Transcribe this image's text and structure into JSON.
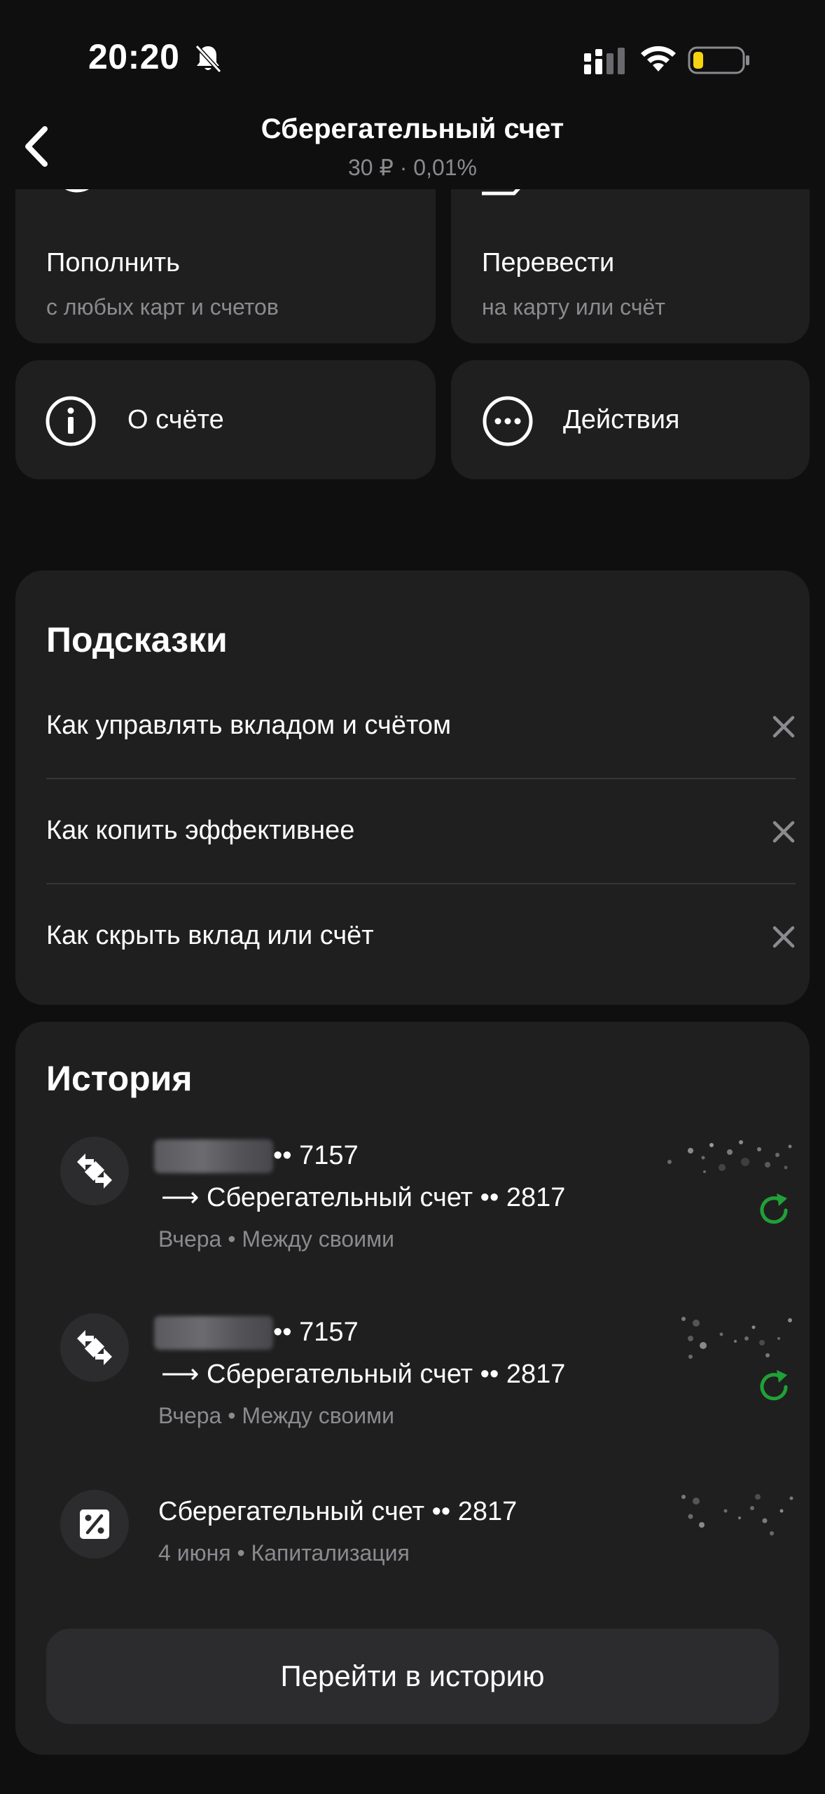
{
  "status_bar": {
    "time": "20:20"
  },
  "header": {
    "title": "Сберегательный счет",
    "subtitle": "30 ₽ · 0,01%"
  },
  "actions": {
    "top_up": {
      "title": "Пополнить",
      "subtitle": "с любых карт и счетов"
    },
    "transfer": {
      "title": "Перевести",
      "subtitle": "на карту или счёт"
    },
    "about": {
      "label": "О счёте"
    },
    "more": {
      "label": "Действия"
    }
  },
  "hints": {
    "title": "Подсказки",
    "items": [
      {
        "label": "Как управлять вкладом и счётом"
      },
      {
        "label": "Как копить эффективнее"
      },
      {
        "label": "Как скрыть вклад или счёт"
      }
    ]
  },
  "history": {
    "title": "История",
    "items": [
      {
        "from_suffix": "•• 7157",
        "to": "⟶ Сберегательный счет •• 2817",
        "meta": "Вчера • Между своими"
      },
      {
        "from_suffix": "•• 7157",
        "to": "⟶ Сберегательный счет •• 2817",
        "meta": "Вчера • Между своими"
      },
      {
        "title": "Сберегательный счет •• 2817",
        "meta": "4 июня • Капитализация"
      }
    ],
    "go_button": "Перейти в историю"
  },
  "colors": {
    "background": "#0f0f10",
    "card": "#1f1f20",
    "accent_green": "#21a038",
    "battery_low": "#f5d30f"
  }
}
